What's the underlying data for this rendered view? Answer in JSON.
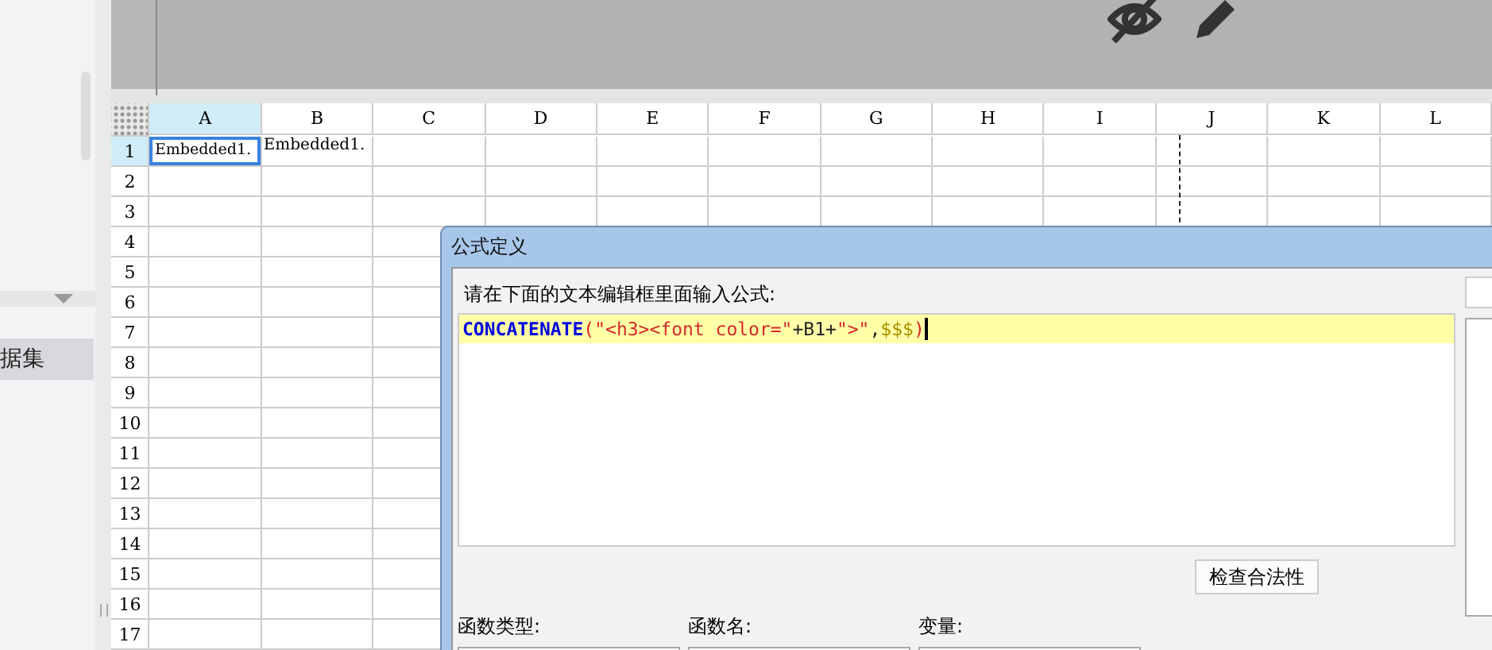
{
  "sidebar": {
    "items": [
      {
        "label": "据集",
        "selected": true
      }
    ]
  },
  "sheet": {
    "columns": [
      {
        "label": "A",
        "selected": true
      },
      {
        "label": "B",
        "selected": false
      },
      {
        "label": "C",
        "selected": false
      },
      {
        "label": "D",
        "selected": false
      },
      {
        "label": "E",
        "selected": false
      },
      {
        "label": "F",
        "selected": false
      },
      {
        "label": "G",
        "selected": false
      },
      {
        "label": "H",
        "selected": false
      },
      {
        "label": "I",
        "selected": false
      },
      {
        "label": "J",
        "selected": false
      },
      {
        "label": "K",
        "selected": false
      },
      {
        "label": "L",
        "selected": false
      }
    ],
    "rows": [
      {
        "label": "1",
        "cells": [
          "Embedded1.",
          "Embedded1."
        ]
      },
      {
        "label": "2",
        "cells": []
      },
      {
        "label": "3",
        "cells": []
      },
      {
        "label": "4",
        "cells": []
      },
      {
        "label": "5",
        "cells": []
      },
      {
        "label": "6",
        "cells": []
      },
      {
        "label": "7",
        "cells": []
      },
      {
        "label": "8",
        "cells": []
      },
      {
        "label": "9",
        "cells": []
      },
      {
        "label": "10",
        "cells": []
      },
      {
        "label": "11",
        "cells": []
      },
      {
        "label": "12",
        "cells": []
      },
      {
        "label": "13",
        "cells": []
      },
      {
        "label": "14",
        "cells": []
      },
      {
        "label": "15",
        "cells": []
      },
      {
        "label": "16",
        "cells": []
      },
      {
        "label": "17",
        "cells": []
      }
    ]
  },
  "dialog": {
    "title": "公式定义",
    "prompt": "请在下面的文本编辑框里面输入公式:",
    "formula": [
      {
        "kind": "function",
        "text": "CONCATENATE"
      },
      {
        "kind": "paren",
        "text": "("
      },
      {
        "kind": "string",
        "text": "\"<h3><font color=\""
      },
      {
        "kind": "plain",
        "text": "+B1+"
      },
      {
        "kind": "string",
        "text": "\">\""
      },
      {
        "kind": "plain",
        "text": ","
      },
      {
        "kind": "variable",
        "text": "$$$"
      },
      {
        "kind": "paren",
        "text": ")"
      }
    ],
    "check_button": "检查合法性",
    "labels": [
      "函数类型:",
      "函数名:",
      "变量:"
    ]
  }
}
